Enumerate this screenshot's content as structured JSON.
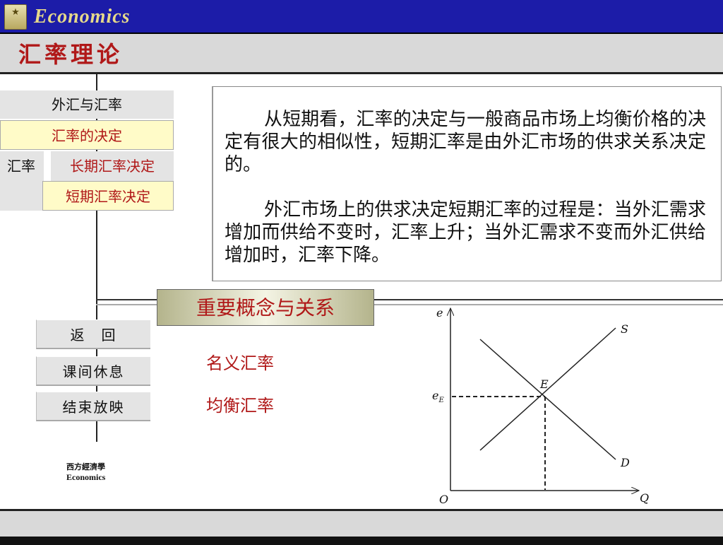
{
  "header": {
    "brand": "Economics",
    "book_icon": "book-icon",
    "title": "汇率理论"
  },
  "nav": {
    "items": [
      {
        "label": "外汇与汇率"
      },
      {
        "label": "汇率的决定"
      },
      {
        "label": "汇率"
      },
      {
        "label": "长期汇率决定"
      },
      {
        "label": "短期汇率决定"
      }
    ]
  },
  "content": {
    "paragraphs": [
      "从短期看，汇率的决定与一般商品市场上均衡价格的决定有很大的相似性，短期汇率是由外汇市场的供求关系决定的。",
      "外汇市场上的供求决定短期汇率的过程是：当外汇需求增加而供给不变时，汇率上升；当外汇需求不变而外汇供给增加时，汇率下降。"
    ]
  },
  "concepts": {
    "banner": "重要概念与关系",
    "links": [
      "名义汇率",
      "均衡汇率"
    ]
  },
  "buttons": {
    "back": "返　回",
    "break": "课间休息",
    "end": "结束放映"
  },
  "footer": {
    "logo_cn": "西方經濟學",
    "logo_en": "Economics"
  },
  "diagram": {
    "y_axis": "e",
    "x_axis": "Q",
    "origin": "O",
    "supply": "S",
    "demand": "D",
    "equilibrium": "E",
    "eq_rate_main": "e",
    "eq_rate_sub": "E"
  },
  "colors": {
    "accent": "#b01818",
    "topbar": "#1c1ca8",
    "brand": "#e6d98a",
    "highlight": "#fffbc8"
  }
}
